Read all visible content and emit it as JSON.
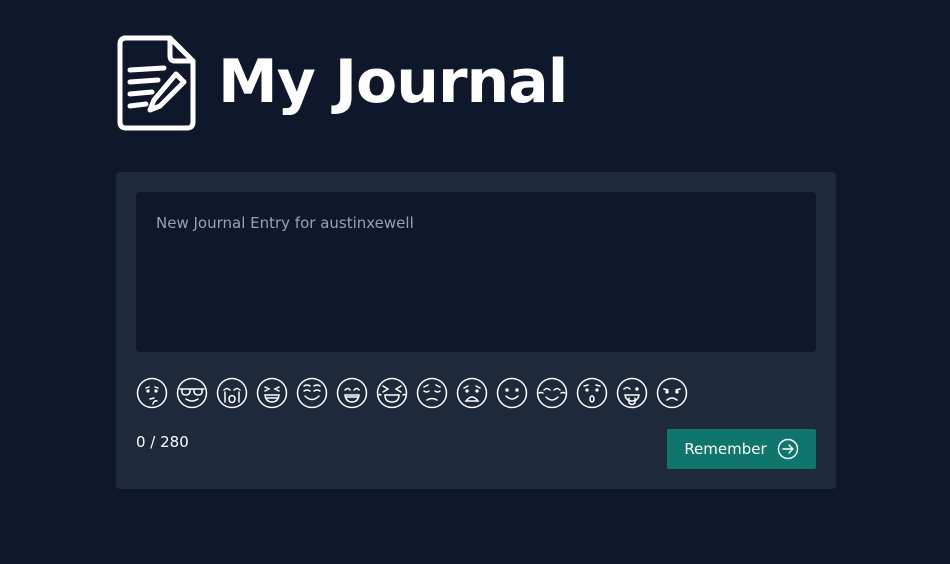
{
  "header": {
    "title": "My Journal",
    "logo_icon": "document-pen-icon"
  },
  "entry": {
    "placeholder": "New Journal Entry for austinxewell",
    "value": ""
  },
  "emojis": [
    "thinking-face-icon",
    "sunglasses-face-icon",
    "crying-face-icon",
    "laughing-face-icon",
    "smiling-face-icon",
    "grinning-face-icon",
    "squinting-face-icon",
    "pensive-face-icon",
    "anguished-face-icon",
    "slight-smile-face-icon",
    "relieved-face-icon",
    "surprised-face-icon",
    "tongue-face-icon",
    "frowning-face-icon"
  ],
  "counter": {
    "text": "0 / 280"
  },
  "submit": {
    "label": "Remember",
    "icon": "arrow-right-circle-icon"
  },
  "colors": {
    "background": "#0f172a",
    "card": "#1e293b",
    "accent": "#0f766e"
  }
}
